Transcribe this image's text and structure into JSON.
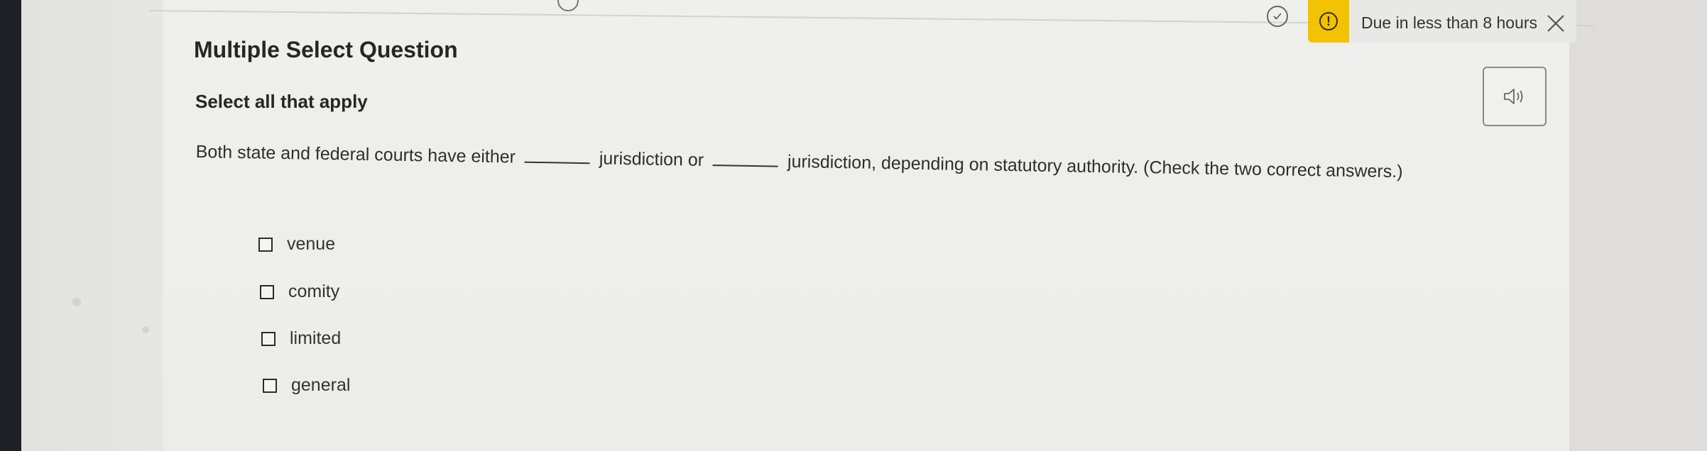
{
  "header": {
    "status_check_icon": "check-circle-icon",
    "due_warning_icon": "exclamation-circle-icon",
    "due_text": "Due in less than 8 hours",
    "close_icon": "close-x-icon",
    "accent_color": "#f3c200"
  },
  "question": {
    "type_label": "Multiple Select Question",
    "instructions": "Select all that apply",
    "prompt_part1": "Both state and federal courts have either",
    "prompt_part2": "jurisdiction or",
    "prompt_part3": "jurisdiction, depending on statutory authority. (Check the two correct answers.)",
    "audio_icon": "speaker-icon"
  },
  "options": [
    {
      "label": "venue",
      "checked": false
    },
    {
      "label": "comity",
      "checked": false
    },
    {
      "label": "limited",
      "checked": false
    },
    {
      "label": "general",
      "checked": false
    }
  ]
}
